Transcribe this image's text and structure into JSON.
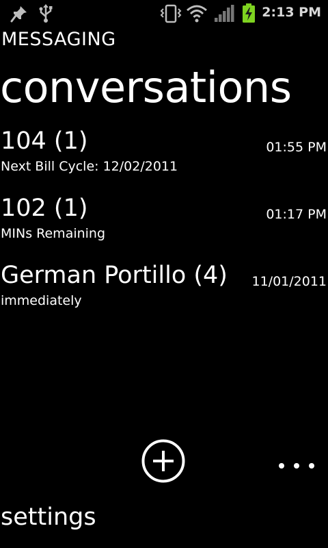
{
  "status_bar": {
    "time": "2:13 PM",
    "icons": [
      "pin-icon",
      "usb-icon",
      "vibrate-icon",
      "wifi-icon",
      "signal-icon",
      "battery-charging-icon"
    ],
    "battery_color": "#7ed320"
  },
  "header": {
    "app_title": "MESSAGING",
    "page_title": "conversations"
  },
  "conversations": [
    {
      "name": "104 (1)",
      "date": "01:55 PM",
      "preview": "Next Bill Cycle: 12/02/2011"
    },
    {
      "name": "102 (1)",
      "date": "01:17 PM",
      "preview": "MINs Remaining"
    },
    {
      "name": "German Portillo (4)",
      "date": "11/01/2011",
      "preview": "immediately"
    }
  ],
  "app_bar": {
    "add_icon": "add-circle-icon",
    "more_icon": "ellipsis-icon"
  },
  "menu": {
    "settings_label": "settings"
  }
}
